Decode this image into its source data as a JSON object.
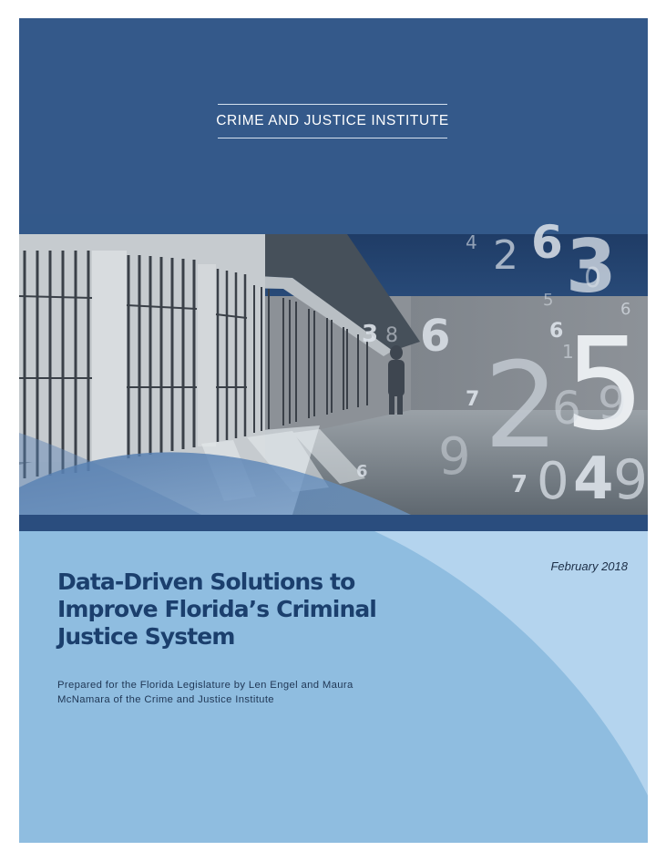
{
  "cover": {
    "organization": "CRIME AND JUSTICE INSTITUTE",
    "date": "February 2018",
    "title": "Data-Driven Solutions to Improve Florida’s Criminal Justice System",
    "byline": "Prepared for the Florida Legislature by Len Engel and Maura McNamara of the Crime and Justice Institute"
  },
  "colors": {
    "banner_blue": "#34598a",
    "title_blue": "#1b3f6d",
    "panel_light_blue": "#8fbde0",
    "arc_light_blue": "#b4d4ee"
  },
  "photo": {
    "description_name": "prison-cell-corridor-photo",
    "overlay_digits": [
      "4",
      "2",
      "6",
      "3",
      "0",
      "5",
      "6",
      "3",
      "6",
      "6",
      "1",
      "7",
      "2",
      "5",
      "6",
      "9",
      "7",
      "9",
      "7",
      "0",
      "4",
      "9",
      "6"
    ]
  }
}
